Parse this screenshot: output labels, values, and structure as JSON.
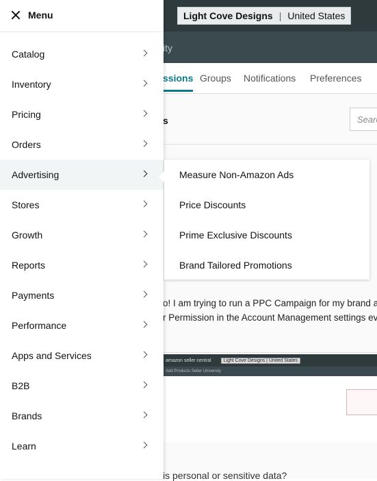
{
  "background": {
    "account_name": "Light Cove Designs",
    "account_region": "United States",
    "subbar_text": "ity",
    "tabs": [
      {
        "label": "ssions"
      },
      {
        "label": "Groups"
      },
      {
        "label": "Notifications"
      },
      {
        "label": "Preferences"
      }
    ],
    "heading": "s",
    "search_placeholder": "Searc",
    "post_line1": "o! I am trying to run a PPC Campaign for my brand an",
    "post_line2": "r Permission in the Account Management settings eve",
    "embedded_account": "Light Cove Designs | United States",
    "embedded_brand": "amazon seller central",
    "embedded_links": "Add Products   Seller University",
    "question": "is personal or sensitive data?"
  },
  "menu": {
    "title": "Menu",
    "items": [
      {
        "label": "Catalog"
      },
      {
        "label": "Inventory"
      },
      {
        "label": "Pricing"
      },
      {
        "label": "Orders"
      },
      {
        "label": "Advertising"
      },
      {
        "label": "Stores"
      },
      {
        "label": "Growth"
      },
      {
        "label": "Reports"
      },
      {
        "label": "Payments"
      },
      {
        "label": "Performance"
      },
      {
        "label": "Apps and Services"
      },
      {
        "label": "B2B"
      },
      {
        "label": "Brands"
      },
      {
        "label": "Learn"
      }
    ],
    "active_item": "Advertising"
  },
  "flyout": {
    "items": [
      {
        "label": "Measure Non-Amazon Ads"
      },
      {
        "label": "Price Discounts"
      },
      {
        "label": "Prime Exclusive Discounts"
      },
      {
        "label": "Brand Tailored Promotions"
      }
    ]
  },
  "colors": {
    "topbar": "#2f3a3d",
    "accent": "#0b7a8a",
    "menu_active_bg": "#f2f5f5"
  }
}
